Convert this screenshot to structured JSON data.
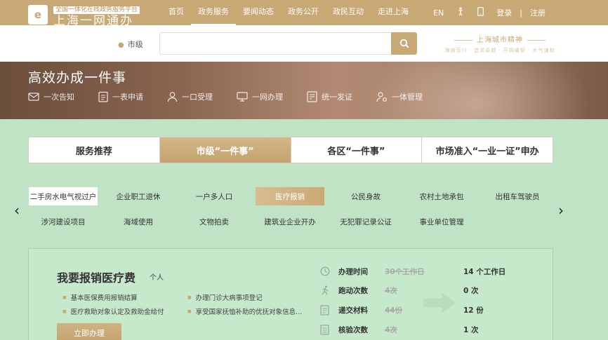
{
  "header": {
    "logo_tagline": "全国一体化在线政务服务平台",
    "logo_name": "上海一网通办",
    "nav": [
      "首页",
      "政务服务",
      "要闻动态",
      "政务公开",
      "政民互动",
      "走进上海"
    ],
    "active_nav_index": 1,
    "lang": "EN",
    "login": "登录",
    "register": "注册",
    "separator": "|"
  },
  "search": {
    "city": "市级",
    "placeholder": "",
    "spirit_title": "上海城市精神",
    "spirit_sub": "海纳百川 · 追求卓越 · 开明睿智 · 大气谦和"
  },
  "banner": {
    "title": "高效办成一件事",
    "steps": [
      "一次告知",
      "一表申请",
      "一口受理",
      "一网办理",
      "统一发证",
      "一体管理"
    ]
  },
  "tabs": [
    "服务推荐",
    "市级“一件事”",
    "各区“一件事”",
    "市场准入“一业一证”申办"
  ],
  "active_tab_index": 1,
  "services": {
    "row1": [
      "二手房水电气视过户",
      "企业职工退休",
      "一户多人口",
      "医疗报销",
      "公民身故",
      "农村土地承包",
      "出租车驾驶员"
    ],
    "row2": [
      "涉河建设项目",
      "海域使用",
      "文物拍卖",
      "建筑业企业开办",
      "无犯罪记录公证",
      "事业单位管理"
    ],
    "highlight_index": 0,
    "active_index": 3
  },
  "detail": {
    "title": "我要报销医疗费",
    "tag": "个人",
    "items": [
      "基本医保费用报销结算",
      "办理门诊大病事项登记",
      "医疗救助对象认定及救助金给付",
      "享受国家抚恤补助的优抚对象信息..."
    ],
    "apply_label": "立即办理",
    "stats": [
      {
        "icon": "clock-icon",
        "label": "办理时间",
        "old": "30个工作日",
        "new": "14 个工作日"
      },
      {
        "icon": "running-icon",
        "label": "跑动次数",
        "old": "4次",
        "new": "0 次"
      },
      {
        "icon": "document-icon",
        "label": "递交材料",
        "old": "44份",
        "new": "12 份"
      },
      {
        "icon": "checklist-icon",
        "label": "核验次数",
        "old": "4次",
        "new": "1 次"
      }
    ]
  },
  "colors": {
    "gold": "#c8a875",
    "bg_green": "#bfe3c4"
  }
}
